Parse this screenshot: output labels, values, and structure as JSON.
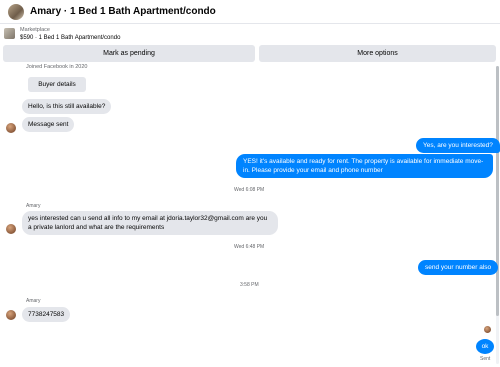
{
  "header": {
    "title": "Amary · 1 Bed 1 Bath Apartment/condo"
  },
  "listing": {
    "source": "Marketplace",
    "price_title": "$590 · 1 Bed 1 Bath Apartment/condo"
  },
  "actions": {
    "pending_label": "Mark as pending",
    "more_label": "More options"
  },
  "thread": {
    "joined": "Joined Facebook in 2020",
    "buyer_details": "Buyer details",
    "messages": [
      {
        "from": "buyer",
        "text": "Hello, is this still available?"
      },
      {
        "from": "buyer",
        "text": "Message sent"
      },
      {
        "from": "me",
        "text": "Yes, are you interested?"
      },
      {
        "from": "me",
        "text": "YES! it's available and ready for rent. The property is available for immediate move-in. Please provide your email and phone number"
      },
      {
        "from": "buyer",
        "text": "yes interested can u send all info to my email at jdoria.taylor32@gmail.com are you a private lanlord and what are the requirements"
      },
      {
        "from": "me",
        "text": "send your number also"
      },
      {
        "from": "buyer",
        "text": "7738247583"
      },
      {
        "from": "me",
        "text": "ok"
      }
    ],
    "timestamps": [
      "Wed 6:08 PM",
      "Wed 6:48 PM",
      "3:58 PM"
    ],
    "sender_name": "Amary",
    "sent_status": "Sent"
  }
}
